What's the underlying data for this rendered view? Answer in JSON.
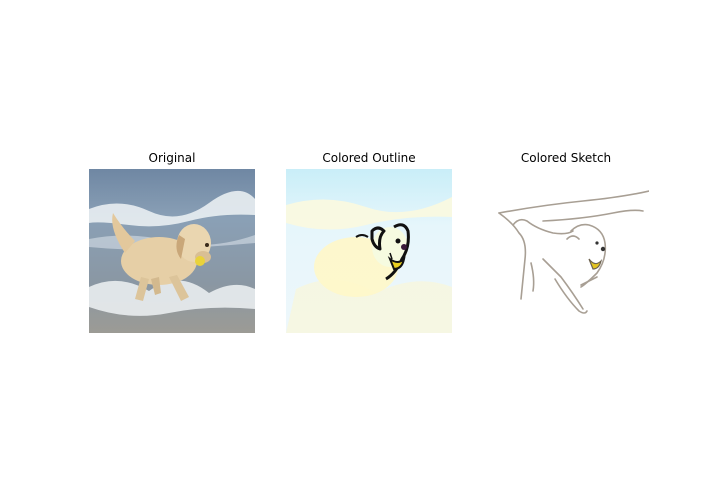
{
  "panels": [
    {
      "title": "Original"
    },
    {
      "title": "Colored Outline"
    },
    {
      "title": "Colored Sketch"
    }
  ],
  "colors": {
    "background": "#ffffff",
    "sea": "#7d94ad",
    "foam": "#e8eef3",
    "dog": "#e6cfa6",
    "ball": "#e9d23a",
    "outline_bg": "#dff3fb",
    "outline_stroke": "#111111",
    "sketch_stroke": "#a89f94"
  }
}
